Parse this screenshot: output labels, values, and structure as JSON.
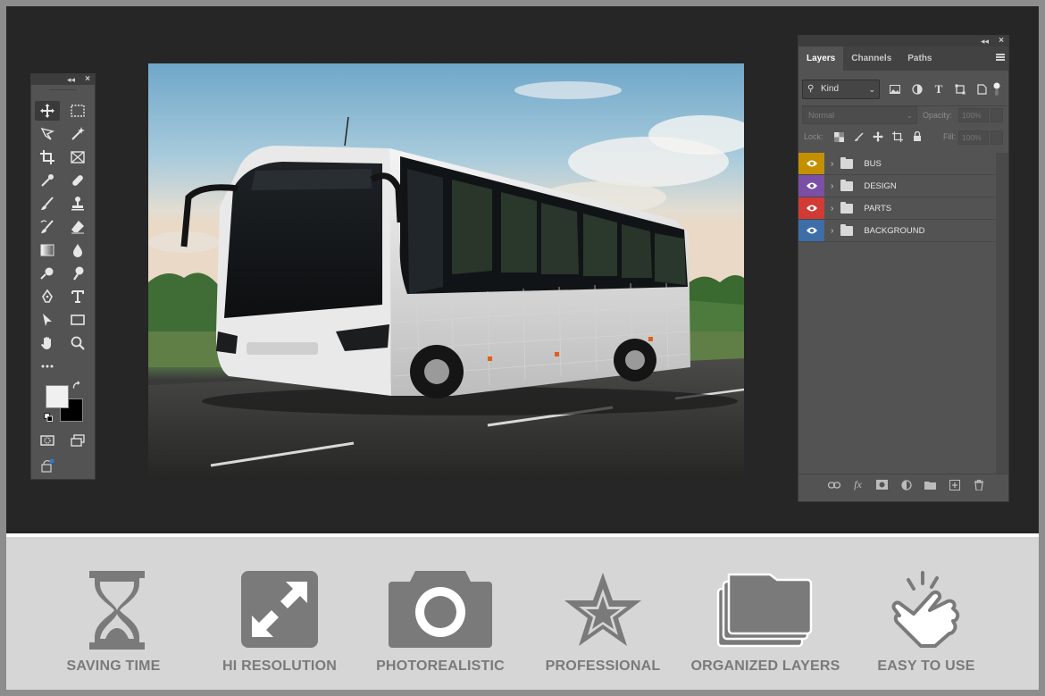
{
  "layers_panel": {
    "tabs": [
      "Layers",
      "Channels",
      "Paths"
    ],
    "filter_kind": "Kind",
    "blend_mode": "Normal",
    "opacity_label": "Opacity:",
    "opacity_value": "100%",
    "lock_label": "Lock:",
    "fill_label": "Fill:",
    "fill_value": "100%",
    "layers": [
      {
        "name": "BUS",
        "color": "#c49000"
      },
      {
        "name": "DESIGN",
        "color": "#7b4fa6"
      },
      {
        "name": "PARTS",
        "color": "#d23b35"
      },
      {
        "name": "BACKGROUND",
        "color": "#3d6ea8"
      }
    ]
  },
  "toolbox": {
    "tools": [
      "move-tool",
      "marquee-tool",
      "lasso-tool",
      "magic-wand-tool",
      "crop-tool",
      "frame-tool",
      "eyedropper-tool",
      "healing-tool",
      "brush-tool",
      "stamp-tool",
      "history-brush-tool",
      "eraser-tool",
      "gradient-tool",
      "blur-tool",
      "dodge-tool",
      "burn-tool",
      "pen-tool",
      "type-tool",
      "path-select-tool",
      "rectangle-tool",
      "hand-tool",
      "zoom-tool",
      "more-tools"
    ],
    "foreground_color": "#f0f0f0",
    "background_color": "#000000"
  },
  "features": [
    {
      "label": "SAVING TIME",
      "icon": "hourglass-icon"
    },
    {
      "label": "HI RESOLUTION",
      "icon": "expand-icon"
    },
    {
      "label": "PHOTOREALISTIC",
      "icon": "camera-icon"
    },
    {
      "label": "PROFESSIONAL",
      "icon": "star-icon"
    },
    {
      "label": "ORGANIZED LAYERS",
      "icon": "folders-icon"
    },
    {
      "label": "EASY TO USE",
      "icon": "tap-hand-icon"
    }
  ]
}
